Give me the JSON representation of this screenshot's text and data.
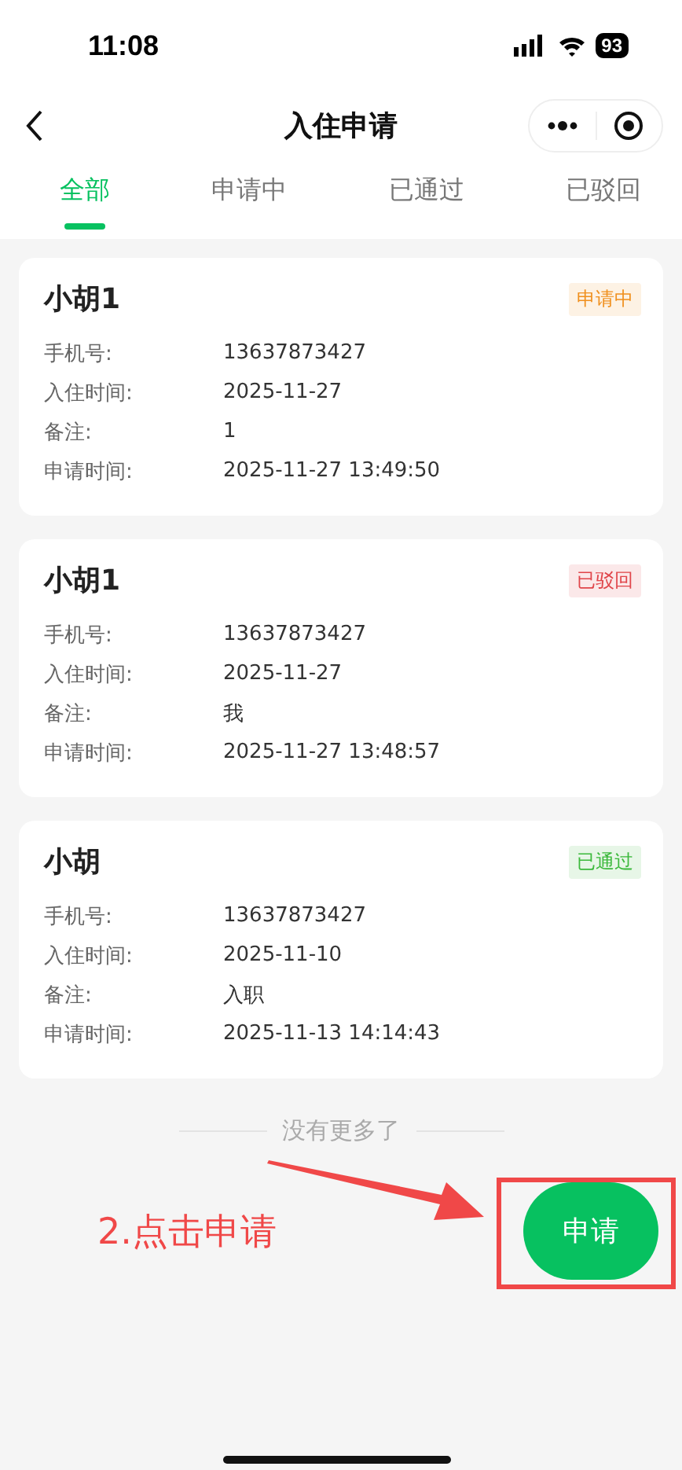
{
  "status_bar": {
    "time": "11:08",
    "battery": "93"
  },
  "nav": {
    "title": "入住申请"
  },
  "tabs": [
    {
      "label": "全部",
      "selected": true
    },
    {
      "label": "申请中",
      "selected": false
    },
    {
      "label": "已通过",
      "selected": false
    },
    {
      "label": "已驳回",
      "selected": false
    }
  ],
  "applications": [
    {
      "name": "小胡1",
      "status": "申请中",
      "color": "#f0901e",
      "fields": [
        {
          "label": "手机号:",
          "value": "13637873427"
        },
        {
          "label": "入住时间:",
          "value": "2025-11-27"
        },
        {
          "label": "备注:",
          "value": "1"
        },
        {
          "label": "申请时间:",
          "value": "2025-11-27 13:49:50"
        }
      ]
    },
    {
      "name": "小胡1",
      "status": "已驳回",
      "color": "#e0454a",
      "fields": [
        {
          "label": "手机号:",
          "value": "13637873427"
        },
        {
          "label": "入住时间:",
          "value": "2025-11-27"
        },
        {
          "label": "备注:",
          "value": "我"
        },
        {
          "label": "申请时间:",
          "value": "2025-11-27 13:48:57"
        }
      ]
    },
    {
      "name": "小胡",
      "status": "已通过",
      "color": "#3cb93c",
      "fields": [
        {
          "label": "手机号:",
          "value": "13637873427"
        },
        {
          "label": "入住时间:",
          "value": "2025-11-10"
        },
        {
          "label": "备注:",
          "value": "入职"
        },
        {
          "label": "申请时间:",
          "value": "2025-11-13 14:14:43"
        }
      ]
    }
  ],
  "end_note": "没有更多了",
  "apply_button": "申请",
  "annotation": {
    "text": "2.点击申请"
  }
}
